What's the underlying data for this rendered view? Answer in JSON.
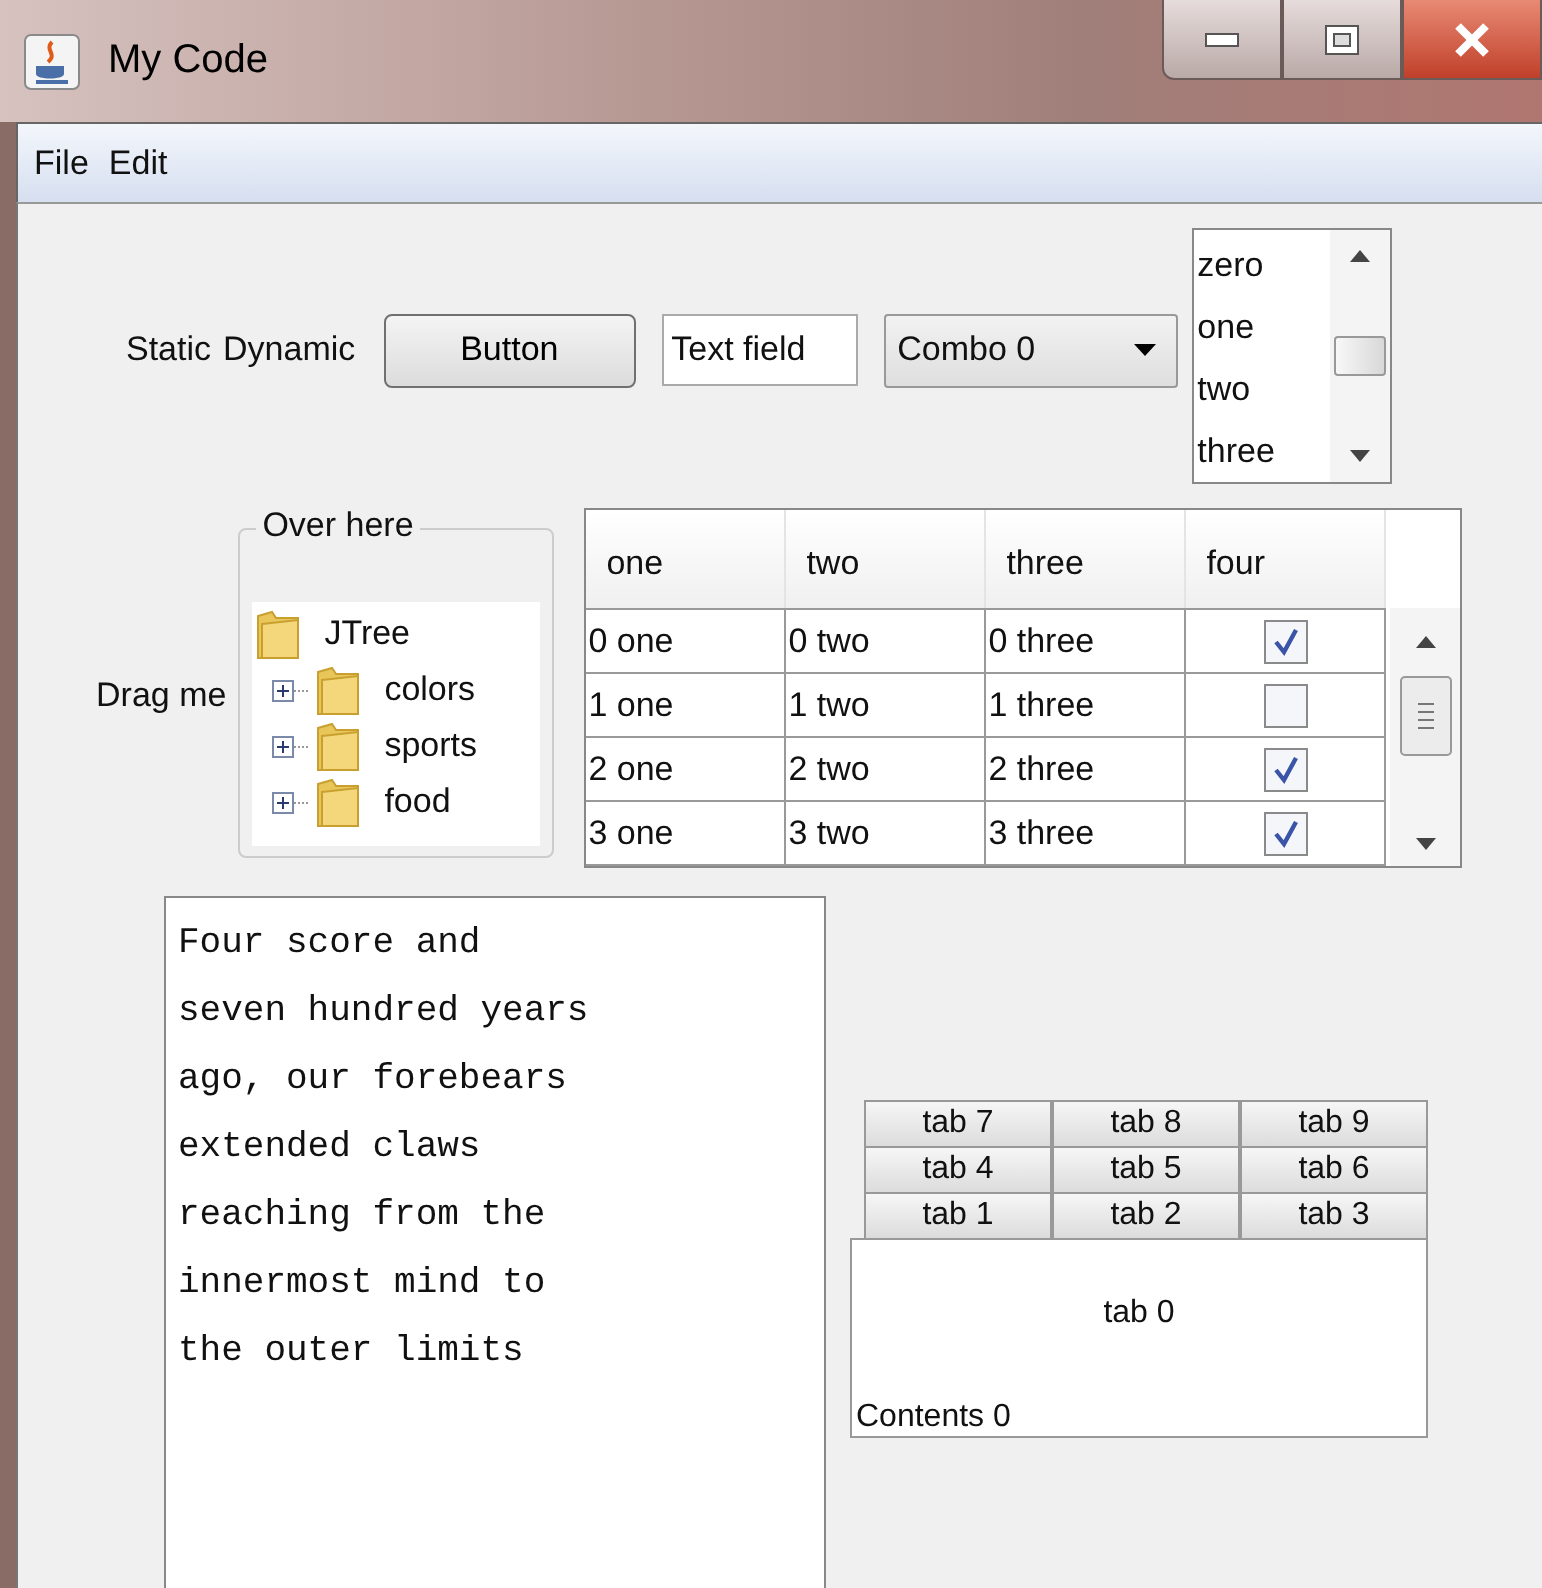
{
  "window": {
    "title": "My Code"
  },
  "menu": [
    "File",
    "Edit"
  ],
  "top_row": {
    "labels": [
      "Static",
      "Dynamic"
    ],
    "button": "Button",
    "text_field": {
      "value": "Text field"
    },
    "combo": {
      "value": "Combo 0"
    },
    "list": {
      "items": [
        {
          "label": "zero",
          "selected": false
        },
        {
          "label": "one",
          "selected": false
        },
        {
          "label": "two",
          "selected": false
        },
        {
          "label": "three",
          "selected": false
        }
      ]
    }
  },
  "drag_label": "Drag me",
  "tree": {
    "title": "Over here",
    "root": {
      "label": "JTree",
      "children": [
        {
          "label": "colors",
          "expanded": false
        },
        {
          "label": "sports",
          "expanded": false
        },
        {
          "label": "food",
          "expanded": false
        }
      ]
    }
  },
  "table": {
    "columns": [
      "one",
      "two",
      "three",
      "four"
    ],
    "rows": [
      {
        "cells": [
          "0 one",
          "0 two",
          "0 three"
        ],
        "checked": true
      },
      {
        "cells": [
          "1 one",
          "1 two",
          "1 three"
        ],
        "checked": false
      },
      {
        "cells": [
          "2 one",
          "2 two",
          "2 three"
        ],
        "checked": true
      },
      {
        "cells": [
          "3 one",
          "3 two",
          "3 three"
        ],
        "checked": true
      }
    ]
  },
  "text_area": {
    "lines": [
      "Four score and",
      "seven hundred years",
      "ago, our forebears",
      "extended claws",
      "reaching from the",
      "innermost mind to",
      "the outer limits"
    ]
  },
  "tabbed_pane": {
    "tab_rows": [
      [
        {
          "label": "tab 7",
          "selected": false
        },
        {
          "label": "tab 8",
          "selected": false
        },
        {
          "label": "tab 9",
          "selected": false
        }
      ],
      [
        {
          "label": "tab 4",
          "selected": false
        },
        {
          "label": "tab 5",
          "selected": false
        },
        {
          "label": "tab 6",
          "selected": false
        }
      ],
      [
        {
          "label": "tab 1",
          "selected": false
        },
        {
          "label": "tab 2",
          "selected": false
        },
        {
          "label": "tab 3",
          "selected": false
        }
      ],
      [
        {
          "label": "tab 0",
          "selected": true
        }
      ]
    ],
    "contents": "Contents 0"
  }
}
